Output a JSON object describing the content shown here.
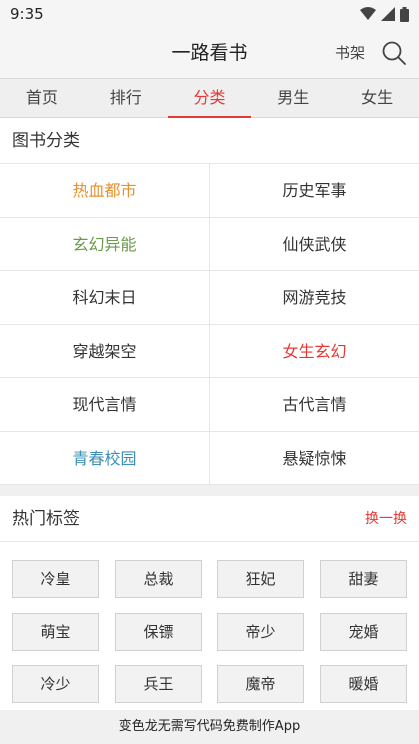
{
  "status": {
    "time": "9:35"
  },
  "header": {
    "title": "一路看书",
    "shelf": "书架"
  },
  "tabs": [
    {
      "label": "首页",
      "active": false
    },
    {
      "label": "排行",
      "active": false
    },
    {
      "label": "分类",
      "active": true
    },
    {
      "label": "男生",
      "active": false
    },
    {
      "label": "女生",
      "active": false
    }
  ],
  "categories": {
    "title": "图书分类",
    "items": [
      {
        "label": "热血都市",
        "color": "#e8902e"
      },
      {
        "label": "历史军事",
        "color": "#333333"
      },
      {
        "label": "玄幻异能",
        "color": "#6a9a4a"
      },
      {
        "label": "仙侠武侠",
        "color": "#333333"
      },
      {
        "label": "科幻末日",
        "color": "#333333"
      },
      {
        "label": "网游竞技",
        "color": "#333333"
      },
      {
        "label": "穿越架空",
        "color": "#333333"
      },
      {
        "label": "女生玄幻",
        "color": "#e53935"
      },
      {
        "label": "现代言情",
        "color": "#333333"
      },
      {
        "label": "古代言情",
        "color": "#333333"
      },
      {
        "label": "青春校园",
        "color": "#3d8fb5"
      },
      {
        "label": "悬疑惊悚",
        "color": "#333333"
      }
    ]
  },
  "hot_tags": {
    "title": "热门标签",
    "refresh": "换一换",
    "tags": [
      "冷皇",
      "总裁",
      "狂妃",
      "甜妻",
      "萌宝",
      "保镖",
      "帝少",
      "宠婚",
      "冷少",
      "兵王",
      "魔帝",
      "暖婚"
    ]
  },
  "footer": {
    "text": "变色龙无需写代码免费制作App"
  },
  "colors": {
    "accent": "#e53935"
  }
}
